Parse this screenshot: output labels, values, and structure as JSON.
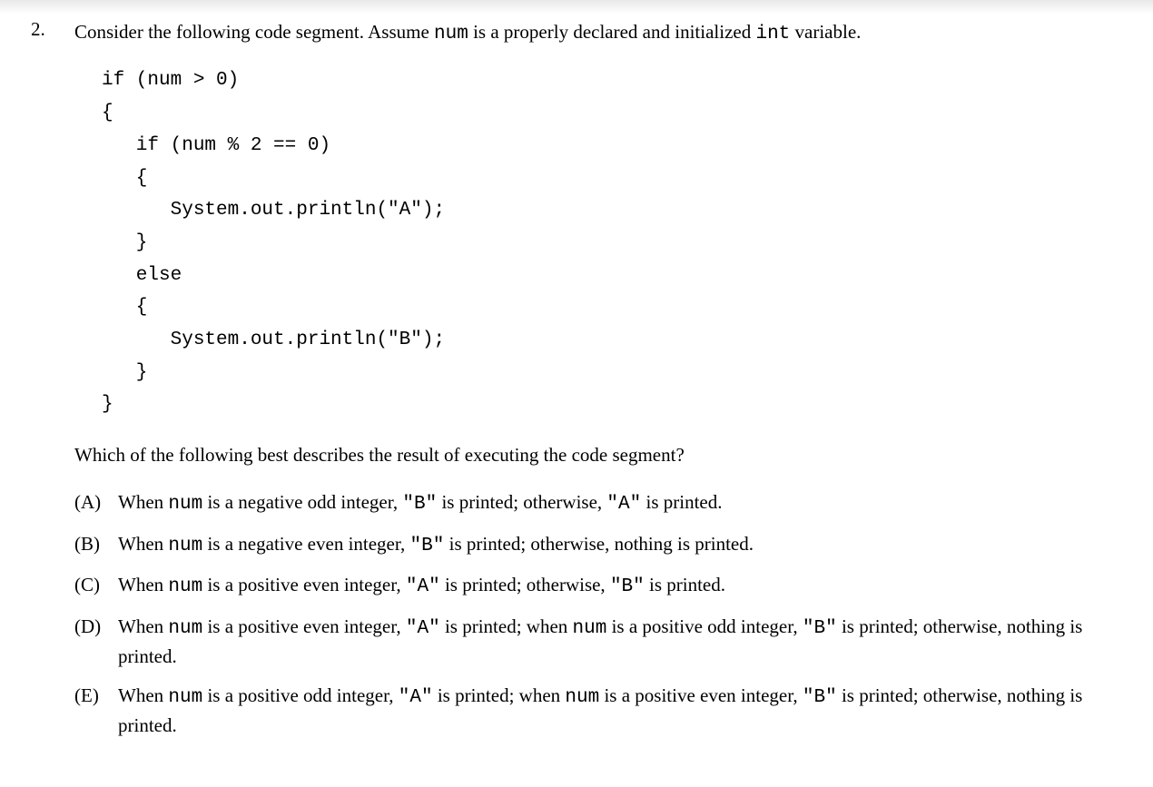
{
  "question": {
    "number": "2.",
    "stem_parts": [
      "Consider the following code segment. Assume ",
      "num",
      " is a properly declared and initialized ",
      "int",
      " variable."
    ],
    "code_lines": [
      "if (num > 0)",
      "{",
      "   if (num % 2 == 0)",
      "   {",
      "      System.out.println(\"A\");",
      "   }",
      "   else",
      "   {",
      "      System.out.println(\"B\");",
      "   }",
      "}"
    ],
    "sub_question": "Which of the following best describes the result of executing the code segment?",
    "choices": [
      {
        "label": "(A)",
        "parts": [
          "When ",
          "num",
          " is a negative odd integer, ",
          "\"B\"",
          " is printed; otherwise, ",
          "\"A\"",
          " is printed."
        ]
      },
      {
        "label": "(B)",
        "parts": [
          "When ",
          "num",
          " is a negative even integer, ",
          "\"B\"",
          " is printed; otherwise, nothing is printed."
        ]
      },
      {
        "label": "(C)",
        "parts": [
          "When ",
          "num",
          " is a positive even integer, ",
          "\"A\"",
          " is printed; otherwise, ",
          "\"B\"",
          " is printed."
        ]
      },
      {
        "label": "(D)",
        "parts": [
          "When ",
          "num",
          " is a positive even integer, ",
          "\"A\"",
          " is printed; when ",
          "num",
          " is a positive odd integer, ",
          "\"B\"",
          " is printed; otherwise, nothing is printed."
        ]
      },
      {
        "label": "(E)",
        "parts": [
          "When ",
          "num",
          " is a positive odd integer, ",
          "\"A\"",
          " is printed; when ",
          "num",
          " is a positive even integer, ",
          "\"B\"",
          " is printed; otherwise, nothing is printed."
        ]
      }
    ]
  }
}
